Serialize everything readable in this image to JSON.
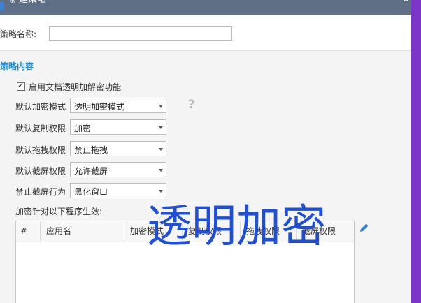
{
  "window": {
    "title": "新建策略",
    "close_glyph": "×"
  },
  "policy": {
    "name_label": "策略名称:",
    "name_value": ""
  },
  "section": {
    "title": "策略内容"
  },
  "enable": {
    "label": "启用文档透明加解密功能",
    "checked": true,
    "check_glyph": "✓"
  },
  "settings": [
    {
      "label": "默认加密模式",
      "value": "透明加密模式"
    },
    {
      "label": "默认复制权限",
      "value": "加密"
    },
    {
      "label": "默认拖拽权限",
      "value": "禁止拖拽"
    },
    {
      "label": "默认截屏权限",
      "value": "允许截屏"
    },
    {
      "label": "禁止截屏行为",
      "value": "黑化窗口"
    }
  ],
  "help_glyph": "?",
  "apps": {
    "label": "加密针对以下程序生效:",
    "columns": [
      "#",
      "应用名",
      "加密模式",
      "复制权限",
      "拖拽权限",
      "截屏权限"
    ],
    "rows": []
  },
  "overlay": {
    "text": "透明加密"
  },
  "colors": {
    "frame": "#7c34c9",
    "accent": "#1f8fd8",
    "overlay": "#1f4fd6"
  },
  "icons": {
    "edit": "pencil-icon",
    "help": "question-icon",
    "close": "close-icon"
  }
}
